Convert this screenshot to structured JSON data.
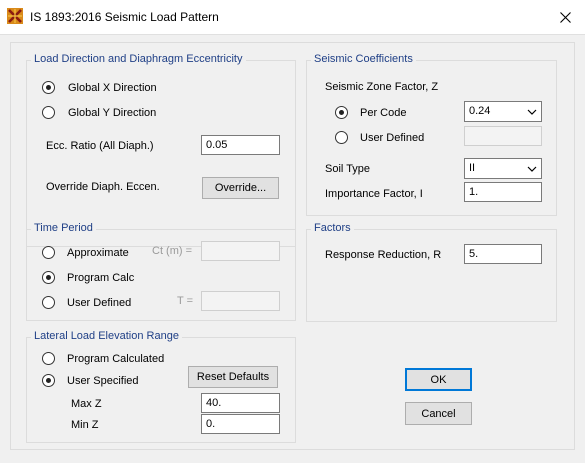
{
  "window": {
    "title": "IS 1893:2016 Seismic Load Pattern",
    "app_icon": "sap-logo-icon",
    "close_icon": "close-icon"
  },
  "load_direction": {
    "legend": "Load Direction and Diaphragm Eccentricity",
    "global_x_label": "Global  X  Direction",
    "global_y_label": "Global  Y  Direction",
    "selected": "global_x",
    "ecc_ratio_label": "Ecc. Ratio (All Diaph.)",
    "ecc_ratio_value": "0.05",
    "override_label": "Override Diaph. Eccen.",
    "override_button": "Override..."
  },
  "time_period": {
    "legend": "Time Period",
    "approximate_label": "Approximate",
    "ct_label": "Ct (m) =",
    "program_calc_label": "Program Calc",
    "user_defined_label": "User Defined",
    "t_label": "T =",
    "selected": "program_calc"
  },
  "lateral_load": {
    "legend": "Lateral Load Elevation Range",
    "program_calculated_label": "Program Calculated",
    "user_specified_label": "User Specified",
    "reset_button": "Reset Defaults",
    "max_z_label": "Max Z",
    "max_z_value": "40.",
    "min_z_label": "Min Z",
    "min_z_value": "0.",
    "selected": "user_specified"
  },
  "seismic_coefficients": {
    "legend": "Seismic Coefficients",
    "zone_factor_label": "Seismic Zone Factor, Z",
    "per_code_label": "Per Code",
    "per_code_value": "0.24",
    "user_defined_label": "User Defined",
    "selected": "per_code",
    "soil_type_label": "Soil Type",
    "soil_type_value": "II",
    "importance_label": "Importance Factor, I",
    "importance_value": "1."
  },
  "factors": {
    "legend": "Factors",
    "response_reduction_label": "Response Reduction, R",
    "response_reduction_value": "5."
  },
  "buttons": {
    "ok": "OK",
    "cancel": "Cancel"
  }
}
